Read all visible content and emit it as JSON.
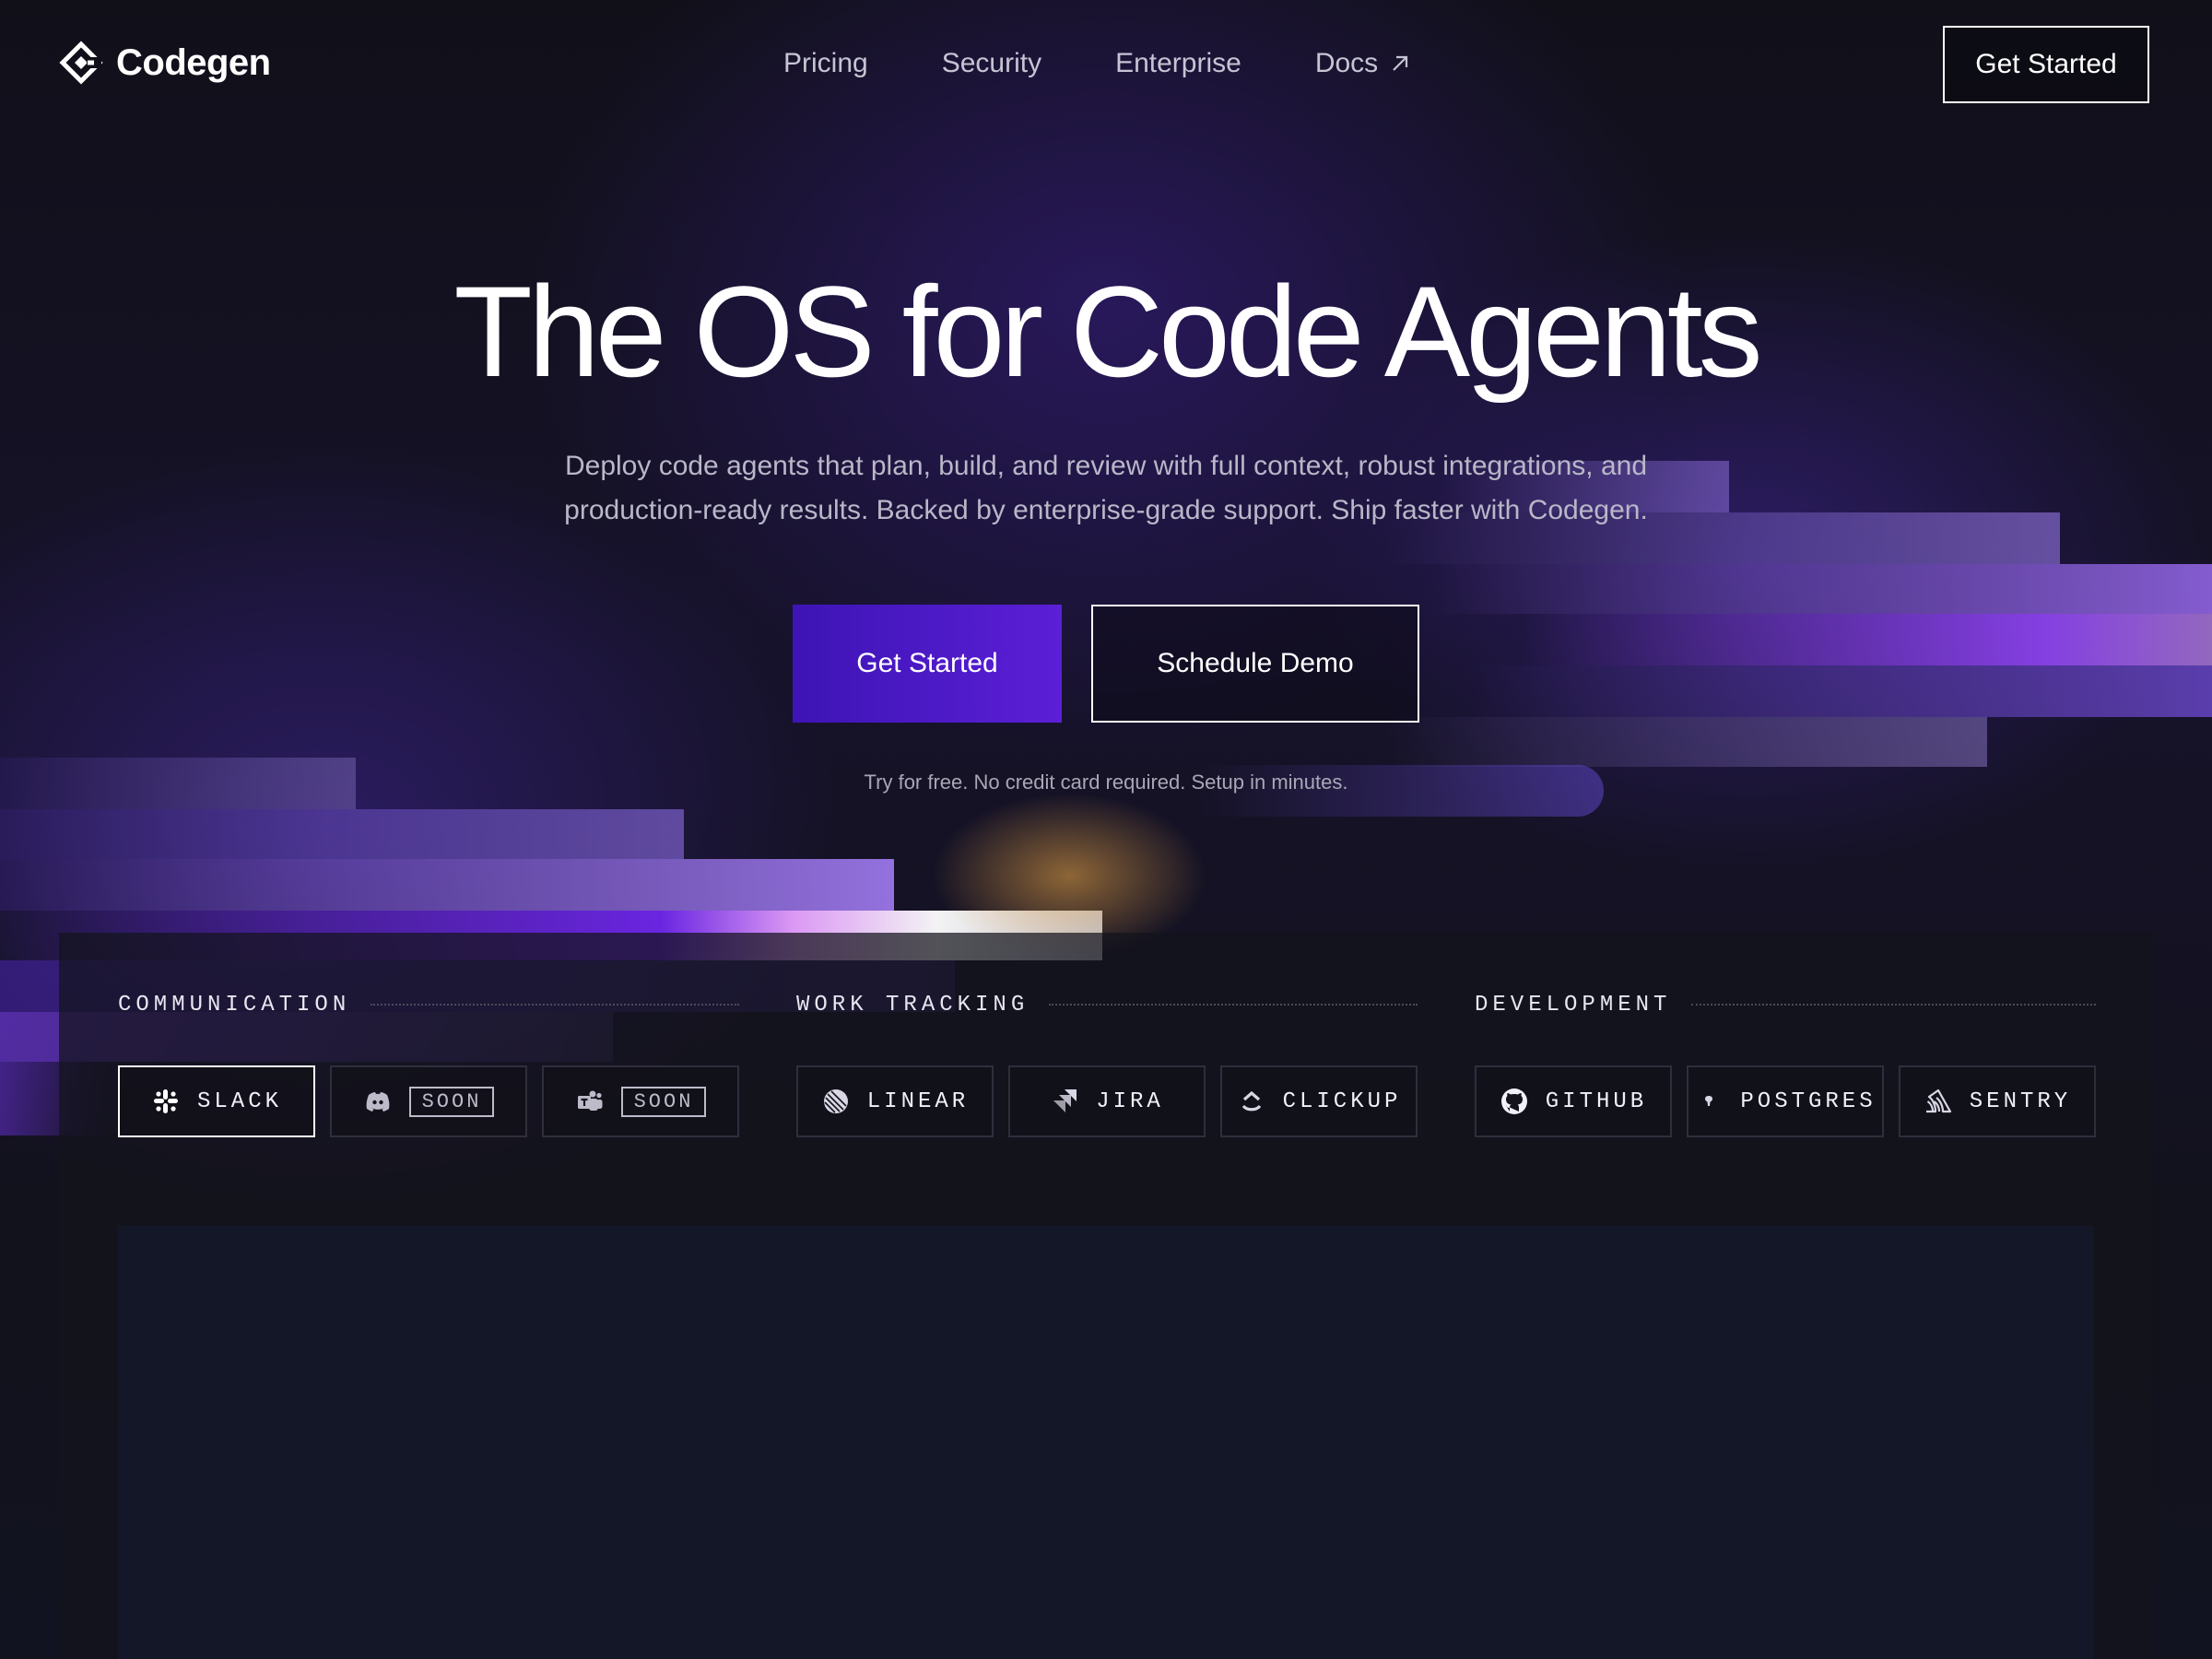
{
  "header": {
    "brand": "Codegen",
    "nav": [
      {
        "label": "Pricing"
      },
      {
        "label": "Security"
      },
      {
        "label": "Enterprise"
      },
      {
        "label": "Docs",
        "icon": "arrow-up-right-icon"
      }
    ],
    "cta_label": "Get Started"
  },
  "hero": {
    "title": "The OS for Code Agents",
    "subtitle": "Deploy code agents that plan, build, and review with full context, robust integrations, and production-ready results. Backed by enterprise-grade support. Ship faster with Codegen.",
    "primary_label": "Get Started",
    "secondary_label": "Schedule Demo",
    "fine_print": "Try for free. No credit card required. Setup in minutes."
  },
  "integrations": {
    "groups": [
      {
        "title": "COMMUNICATION",
        "items": [
          {
            "label": "SLACK",
            "icon": "slack-icon",
            "selected": true
          },
          {
            "badge": "SOON",
            "icon": "discord-icon"
          },
          {
            "badge": "SOON",
            "icon": "teams-icon"
          }
        ]
      },
      {
        "title": "WORK TRACKING",
        "items": [
          {
            "label": "LINEAR",
            "icon": "linear-icon"
          },
          {
            "label": "JIRA",
            "icon": "jira-icon"
          },
          {
            "label": "CLICKUP",
            "icon": "clickup-icon"
          }
        ]
      },
      {
        "title": "DEVELOPMENT",
        "items": [
          {
            "label": "GITHUB",
            "icon": "github-icon"
          },
          {
            "label": "POSTGRES",
            "icon": "postgres-icon"
          },
          {
            "label": "SENTRY",
            "icon": "sentry-icon"
          }
        ]
      }
    ]
  },
  "colors": {
    "primary_button": "#4a18c8",
    "background": "#101018",
    "accent_glow": "#6c3cf0"
  }
}
